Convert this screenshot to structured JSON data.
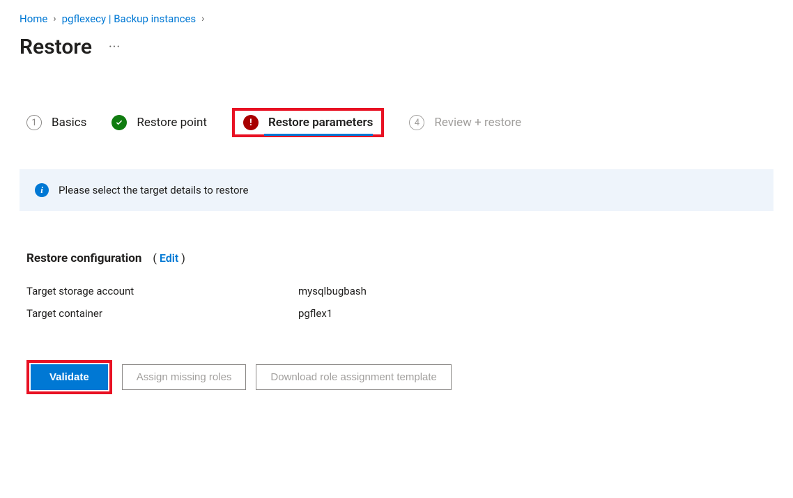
{
  "breadcrumb": {
    "home": "Home",
    "item1": "pgflexecy | Backup instances"
  },
  "page_title": "Restore",
  "wizard": {
    "step1": {
      "num": "1",
      "label": "Basics"
    },
    "step2": {
      "label": "Restore point"
    },
    "step3": {
      "label": "Restore parameters"
    },
    "step4": {
      "num": "4",
      "label": "Review + restore"
    }
  },
  "banner": {
    "text": "Please select the target details to restore"
  },
  "config": {
    "heading": "Restore configuration",
    "edit_label": "Edit",
    "rows": {
      "storage_account": {
        "key": "Target storage account",
        "val": "mysqlbugbash"
      },
      "container": {
        "key": "Target container",
        "val": "pgflex1"
      }
    }
  },
  "buttons": {
    "validate": "Validate",
    "assign_roles": "Assign missing roles",
    "download_template": "Download role assignment template"
  }
}
